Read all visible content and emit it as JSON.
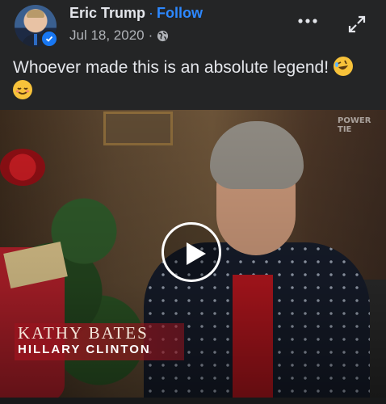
{
  "post": {
    "author_name": "Eric Trump",
    "separator": "·",
    "follow_label": "Follow",
    "date": "Jul 18, 2020",
    "meta_separator": "·",
    "privacy_icon": "globe-icon",
    "caption": "Whoever made this is an absolute legend!"
  },
  "header_actions": {
    "more_icon": "more-options-icon",
    "expand_icon": "expand-icon"
  },
  "video": {
    "watermark": "POWER TIE",
    "lower_third_name": "KATHY BATES",
    "lower_third_role": "HILLARY CLINTON",
    "play_icon": "play-icon"
  },
  "colors": {
    "accent": "#2d88ff",
    "background": "#242526",
    "verified": "#1877f2"
  }
}
